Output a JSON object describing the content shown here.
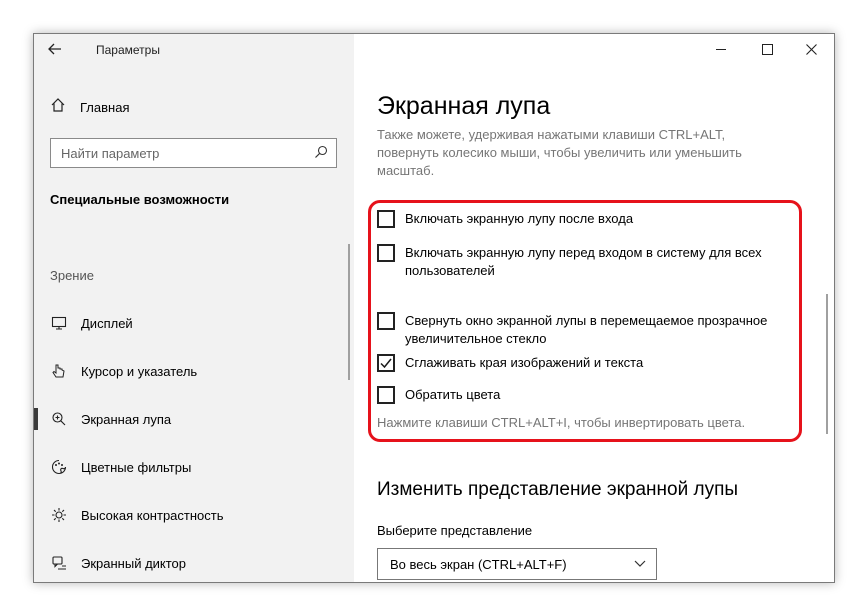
{
  "window": {
    "title": "Параметры"
  },
  "sidebar": {
    "home_label": "Главная",
    "search_placeholder": "Найти параметр",
    "section_title": "Специальные возможности",
    "group_label": "Зрение",
    "items": [
      {
        "label": "Дисплей",
        "icon": "display-icon"
      },
      {
        "label": "Курсор и указатель",
        "icon": "cursor-icon"
      },
      {
        "label": "Экранная лупа",
        "icon": "magnifier-icon",
        "active": true
      },
      {
        "label": "Цветные фильтры",
        "icon": "color-filters-icon"
      },
      {
        "label": "Высокая контрастность",
        "icon": "high-contrast-icon"
      },
      {
        "label": "Экранный диктор",
        "icon": "narrator-icon"
      }
    ]
  },
  "main": {
    "title": "Экранная лупа",
    "description": "Также можете, удерживая нажатыми клавиши CTRL+ALT, повернуть колесико мыши, чтобы увеличить или уменьшить масштаб.",
    "options": [
      {
        "label": "Включать экранную лупу после входа",
        "checked": false
      },
      {
        "label": "Включать экранную лупу перед входом в систему для всех пользователей",
        "checked": false
      },
      {
        "label": "Свернуть окно экранной лупы в перемещаемое прозрачное увеличительное стекло",
        "checked": false
      },
      {
        "label": "Сглаживать края изображений и текста",
        "checked": true
      },
      {
        "label": "Обратить цвета",
        "checked": false
      }
    ],
    "invert_hint": "Нажмите клавиши CTRL+ALT+I, чтобы инвертировать цвета.",
    "view_heading": "Изменить представление экранной лупы",
    "view_select_label": "Выберите представление",
    "view_select_value": "Во весь экран (CTRL+ALT+F)"
  },
  "colors": {
    "highlight": "#e6121b",
    "check": "#1a1a1a"
  }
}
